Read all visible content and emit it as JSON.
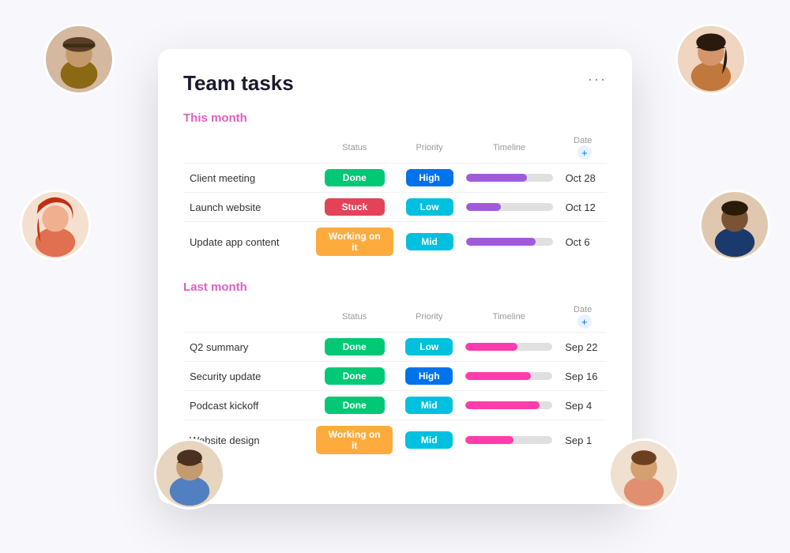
{
  "card": {
    "title": "Team tasks",
    "menu_label": "···"
  },
  "sections": [
    {
      "id": "this-month",
      "title": "This month",
      "columns": [
        "Status",
        "Priority",
        "Timeline",
        "Date"
      ],
      "tasks": [
        {
          "name": "Client meeting",
          "status": "Done",
          "status_type": "done",
          "priority": "High",
          "priority_type": "high",
          "timeline_pct": 70,
          "timeline_color": "purple",
          "date": "Oct 28"
        },
        {
          "name": "Launch website",
          "status": "Stuck",
          "status_type": "stuck",
          "priority": "Low",
          "priority_type": "low",
          "timeline_pct": 40,
          "timeline_color": "purple",
          "date": "Oct 12"
        },
        {
          "name": "Update app content",
          "status": "Working on it",
          "status_type": "working",
          "priority": "Mid",
          "priority_type": "mid",
          "timeline_pct": 80,
          "timeline_color": "purple",
          "date": "Oct 6"
        }
      ]
    },
    {
      "id": "last-month",
      "title": "Last month",
      "columns": [
        "Status",
        "Priority",
        "Timeline",
        "Date"
      ],
      "tasks": [
        {
          "name": "Q2 summary",
          "status": "Done",
          "status_type": "done",
          "priority": "Low",
          "priority_type": "low",
          "timeline_pct": 60,
          "timeline_color": "pink",
          "date": "Sep 22"
        },
        {
          "name": "Security update",
          "status": "Done",
          "status_type": "done",
          "priority": "High",
          "priority_type": "high",
          "timeline_pct": 75,
          "timeline_color": "pink",
          "date": "Sep 16"
        },
        {
          "name": "Podcast kickoff",
          "status": "Done",
          "status_type": "done",
          "priority": "Mid",
          "priority_type": "mid",
          "timeline_pct": 85,
          "timeline_color": "pink",
          "date": "Sep 4"
        },
        {
          "name": "Website design",
          "status": "Working on it",
          "status_type": "working",
          "priority": "Mid",
          "priority_type": "mid",
          "timeline_pct": 55,
          "timeline_color": "pink",
          "date": "Sep 1"
        }
      ]
    }
  ]
}
